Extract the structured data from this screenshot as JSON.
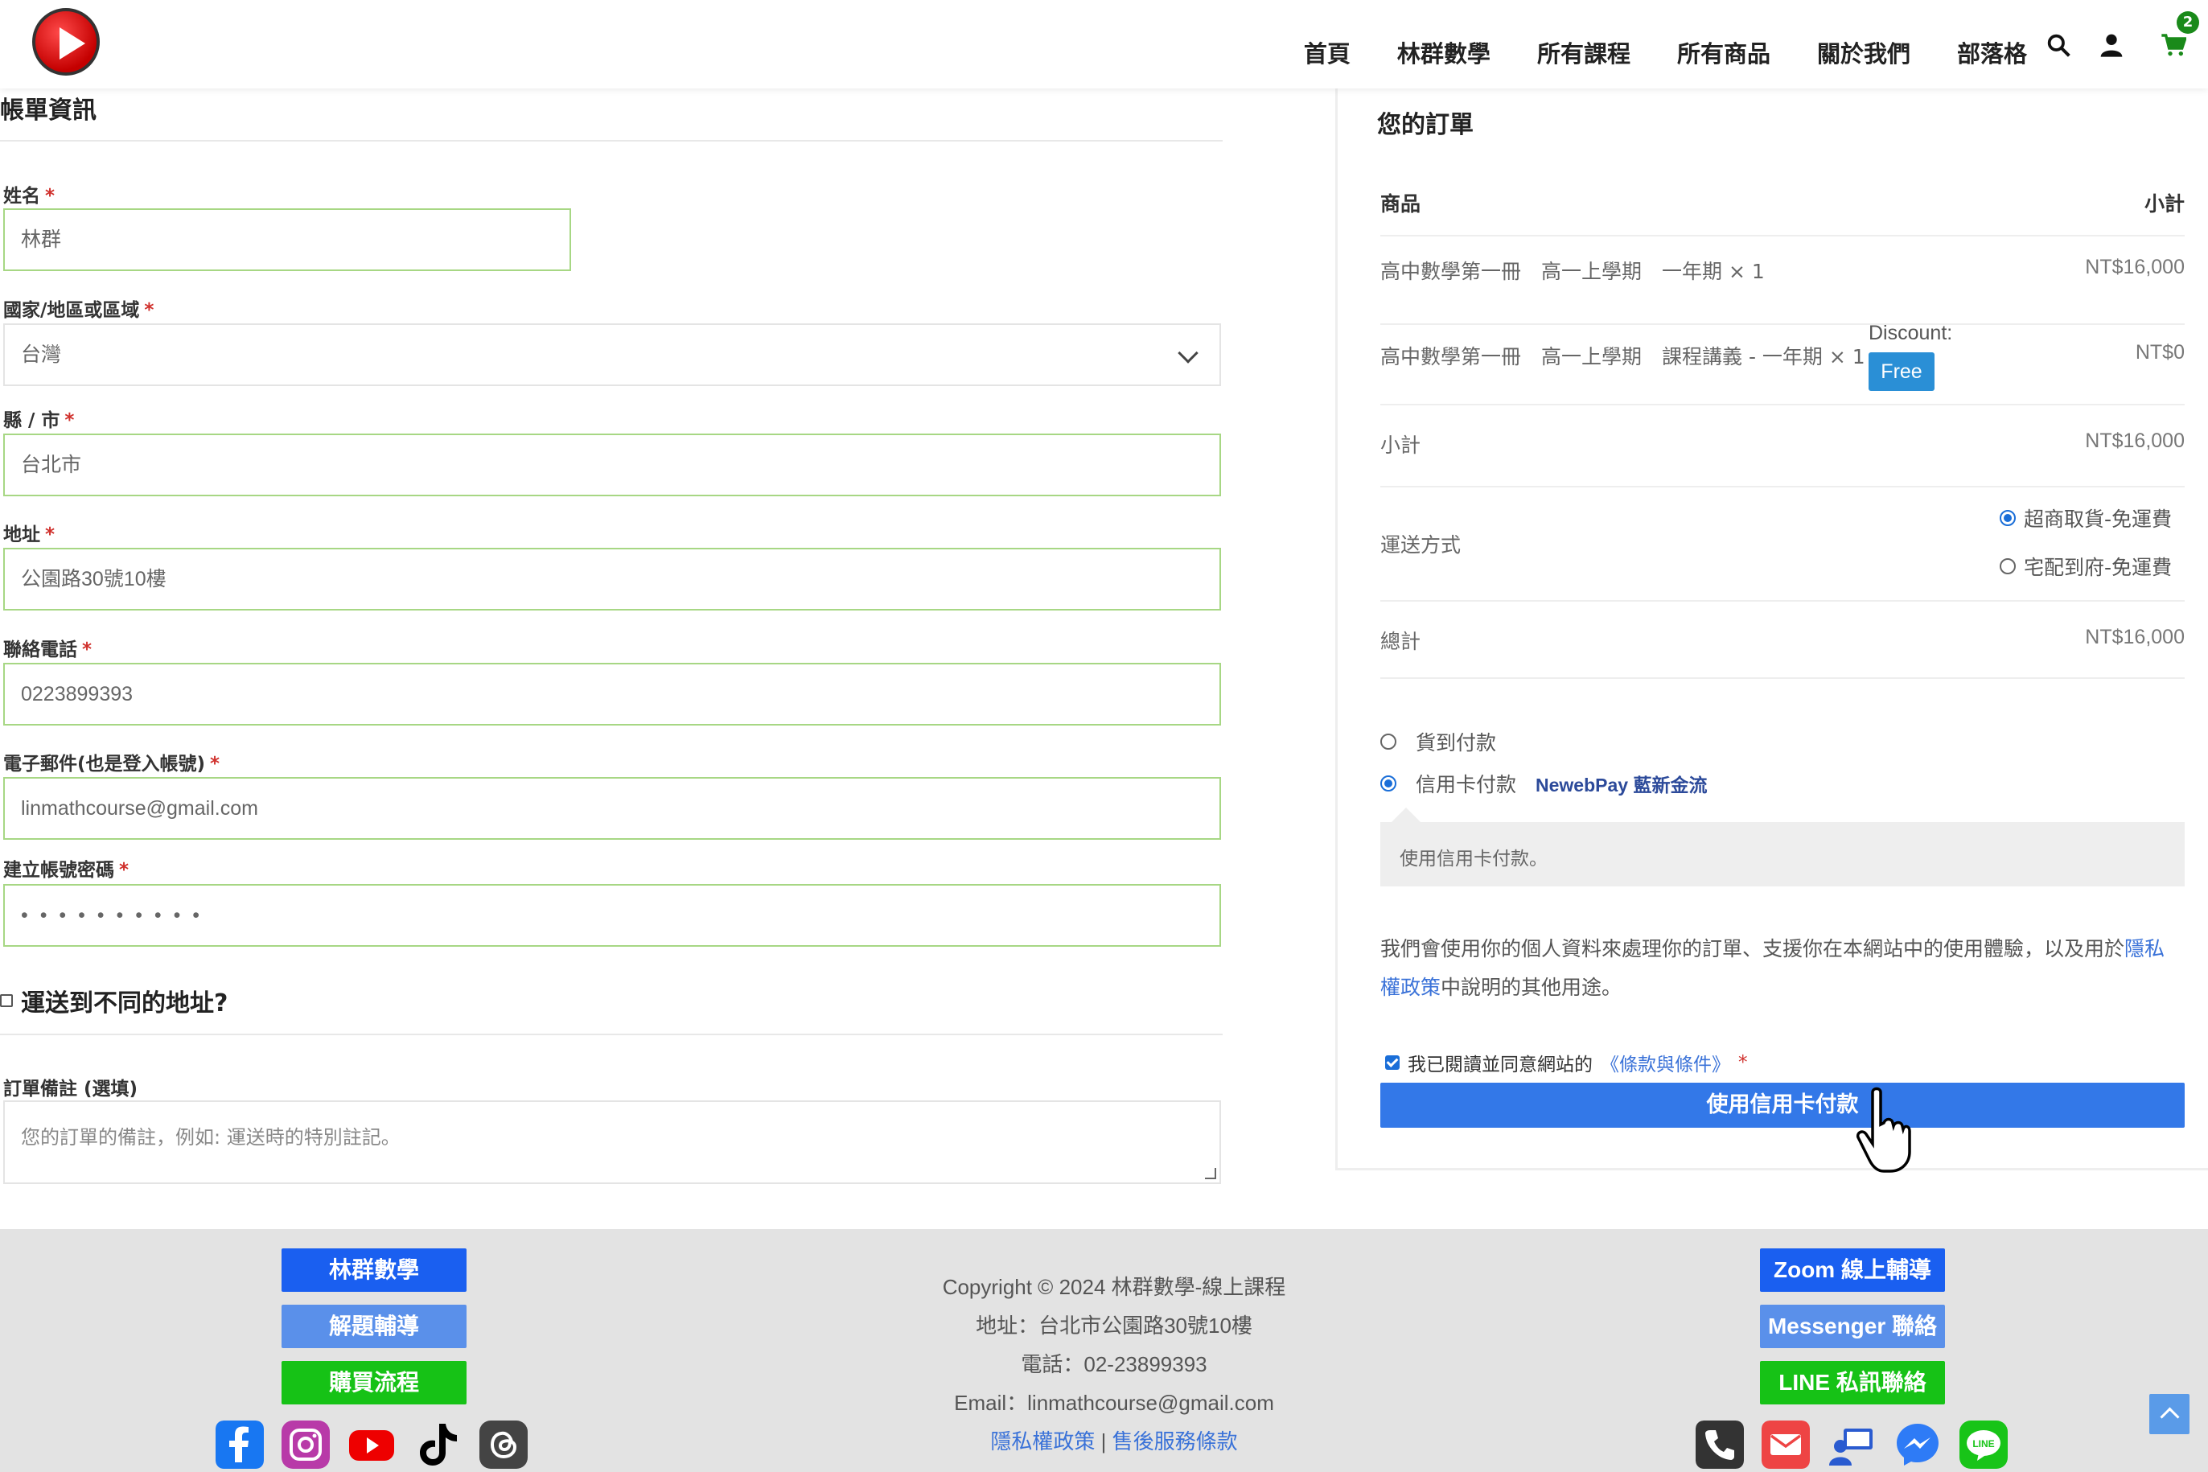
{
  "header": {
    "nav": [
      "首頁",
      "林群數學",
      "所有課程",
      "所有商品",
      "關於我們",
      "部落格"
    ],
    "cart_count": "2"
  },
  "billing": {
    "title": "帳單資訊",
    "name_label": "姓名",
    "name_value": "林群",
    "country_label": "國家/地區或區域",
    "country_value": "台灣",
    "city_label": "縣 / 市",
    "city_value": "台北市",
    "address_label": "地址",
    "address_value": "公園路30號10樓",
    "phone_label": "聯絡電話",
    "phone_value": "0223899393",
    "email_label": "電子郵件(也是登入帳號)",
    "email_value": "linmathcourse@gmail.com",
    "password_label": "建立帳號密碼",
    "password_value": "• • • • • • • • • •",
    "required_mark": "*",
    "ship_diff_label": "運送到不同的地址?",
    "notes_label": "訂單備註 (選填)",
    "notes_placeholder": "您的訂單的備註，例如: 運送時的特別註記。"
  },
  "order": {
    "title": "您的訂單",
    "col_product": "商品",
    "col_subtotal": "小計",
    "items": [
      {
        "name": "高中數學第一冊　高一上學期　一年期 × 1",
        "price": "NT$16,000"
      },
      {
        "name": "高中數學第一冊　高一上學期　課程講義 - 一年期 × 1",
        "price": "NT$0",
        "discount_label": "Discount:",
        "discount_tag": "Free"
      }
    ],
    "subtotal_label": "小計",
    "subtotal_value": "NT$16,000",
    "shipping_label": "運送方式",
    "shipping_options": [
      {
        "label": "超商取貨-免運費",
        "selected": true
      },
      {
        "label": "宅配到府-免運費",
        "selected": false
      }
    ],
    "total_label": "總計",
    "total_value": "NT$16,000",
    "payment_cod": "貨到付款",
    "payment_card": "信用卡付款",
    "newebpay_brand": "NewebPay 藍新金流",
    "payment_desc": "使用信用卡付款。",
    "privacy_text_1": "我們會使用你的個人資料來處理你的訂單、支援你在本網站中的使用體驗，以及用於",
    "privacy_link": "隱私權政策",
    "privacy_text_2": "中說明的其他用途。",
    "terms_text": "我已閱讀並同意網站的",
    "terms_link": "《條款與條件》",
    "terms_req": "*",
    "pay_button": "使用信用卡付款"
  },
  "footer": {
    "left_buttons": [
      {
        "label": "林群數學",
        "color": "#1a5ff0"
      },
      {
        "label": "解題輔導",
        "color": "#5a90ea"
      },
      {
        "label": "購買流程",
        "color": "#16c216"
      }
    ],
    "right_buttons": [
      {
        "label": "Zoom 線上輔導",
        "color": "#1a5ff0"
      },
      {
        "label": "Messenger 聯絡",
        "color": "#5a90ea"
      },
      {
        "label": "LINE 私訊聯絡",
        "color": "#16c216"
      }
    ],
    "copyright": "Copyright © 2024 林群數學-線上課程",
    "address": "地址：台北市公園路30號10樓",
    "phone": "電話：02-23899393",
    "email": "Email：linmathcourse@gmail.com",
    "privacy_link": "隱私權政策",
    "separator": "|",
    "service_link": "售後服務條款",
    "social_icons": [
      "facebook-icon",
      "instagram-icon",
      "youtube-icon",
      "tiktok-icon",
      "threads-icon"
    ],
    "contact_icons": [
      "phone-icon",
      "mail-icon",
      "video-call-icon",
      "messenger-icon",
      "line-icon"
    ]
  }
}
